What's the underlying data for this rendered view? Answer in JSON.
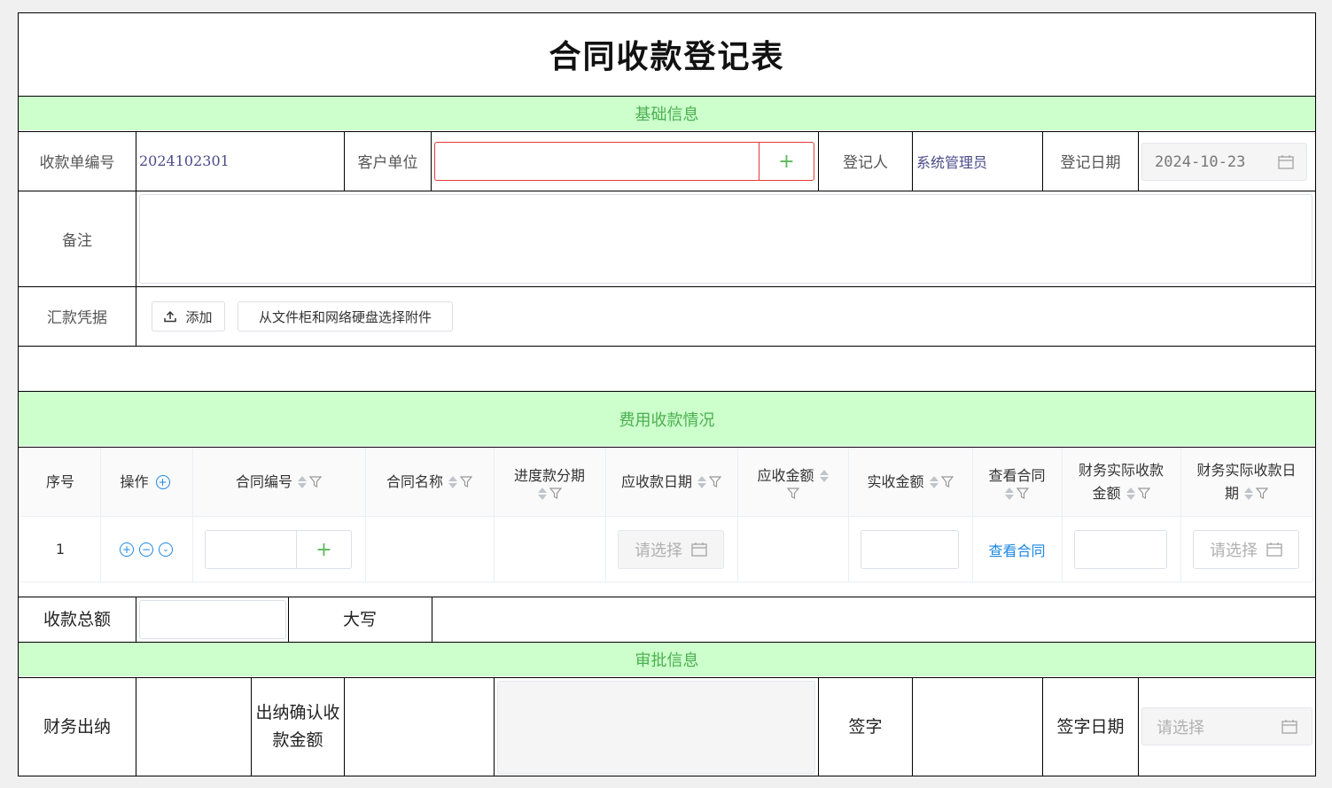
{
  "form": {
    "title": "合同收款登记表",
    "sections": {
      "basic": "基础信息",
      "fees": "费用收款情况",
      "approval": "审批信息"
    },
    "basic": {
      "receipt_no_label": "收款单编号",
      "receipt_no_value": "2024102301",
      "customer_label": "客户单位",
      "customer_value": "",
      "registrant_label": "登记人",
      "registrant_value": "系统管理员",
      "reg_date_label": "登记日期",
      "reg_date_value": "2024-10-23",
      "remark_label": "备注",
      "remark_value": "",
      "voucher_label": "汇款凭据",
      "add_button": "添加",
      "choose_button": "从文件柜和网络硬盘选择附件"
    },
    "table": {
      "headers": {
        "seq": "序号",
        "op": "操作",
        "contract_no": "合同编号",
        "contract_name": "合同名称",
        "installment_l1": "进度款分期",
        "due_date": "应收款日期",
        "due_amount": "应收金额",
        "actual_amount": "实收金额",
        "view_contract": "查看合同",
        "fin_amount_l1": "财务实际收款",
        "fin_amount_l2": "金额",
        "fin_date_l1": "财务实际收款日",
        "fin_date_l2": "期"
      },
      "rows": [
        {
          "seq": "1",
          "due_date_placeholder": "请选择",
          "view_link": "查看合同",
          "fin_date_placeholder": "请选择"
        }
      ]
    },
    "totals": {
      "total_label": "收款总额",
      "total_value": "",
      "upper_label": "大写",
      "upper_value": ""
    },
    "approval": {
      "cashier_label": "财务出纳",
      "confirm_label_l1": "出纳确认收",
      "confirm_label_l2": "款金额",
      "sign_label": "签字",
      "sign_date_label": "签字日期",
      "sign_date_placeholder": "请选择"
    }
  },
  "colors": {
    "section_bg": "#ccffcc",
    "section_text": "#4caf50",
    "required_border": "#e53935",
    "link": "#1e88e5",
    "add_green": "#5cb85c"
  },
  "icons": [
    "upload-icon",
    "calendar-icon",
    "plus-icon",
    "plus-circle-icon",
    "minus-circle-icon",
    "chevron-down-circle-icon",
    "sort-icon",
    "filter-icon"
  ]
}
